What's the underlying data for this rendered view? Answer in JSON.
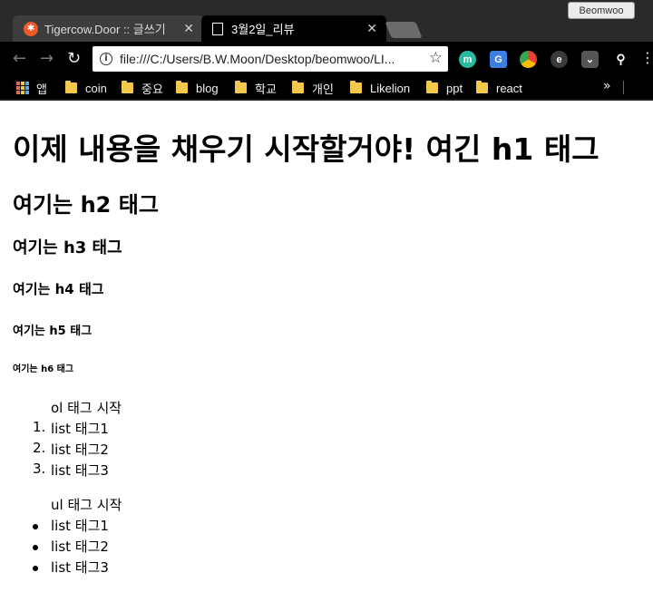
{
  "browser": {
    "tabs": [
      {
        "title": "Tigercow.Door :: 글쓰기",
        "active": false
      },
      {
        "title": "3월2일_리뷰",
        "active": true
      }
    ],
    "profile_name": "Beomwoo",
    "address_bar": {
      "url": "file:///C:/Users/B.W.Moon/Desktop/beomwoo/LI..."
    },
    "bookmarks": [
      "앱",
      "coin",
      "중요",
      "blog",
      "학교",
      "개인",
      "Likelion",
      "ppt",
      "react"
    ],
    "bookmarks_overflow": "»",
    "extensions": [
      "mint-extension-icon",
      "translate-icon",
      "chrome-apps-icon",
      "evernote-icon",
      "pocket-icon",
      "search-extension-icon"
    ],
    "menu_icon": "⋮"
  },
  "page": {
    "h1": "이제 내용을 채우기 시작할거야! 여긴 h1 태그",
    "h2": "여기는 h2 태그",
    "h3": "여기는 h3 태그",
    "h4": "여기는 h4 태그",
    "h5": "여기는 h5 태그",
    "h6": "여기는 h6 태그",
    "ordered_list": {
      "heading": "ol 태그 시작",
      "items": [
        "list 태그1",
        "list 태그2",
        "list 태그3"
      ],
      "markers": [
        "1.",
        "2.",
        "3."
      ]
    },
    "unordered_list": {
      "heading": "ul 태그 시작",
      "items": [
        "list 태그1",
        "list 태그2",
        "list 태그3"
      ]
    }
  }
}
